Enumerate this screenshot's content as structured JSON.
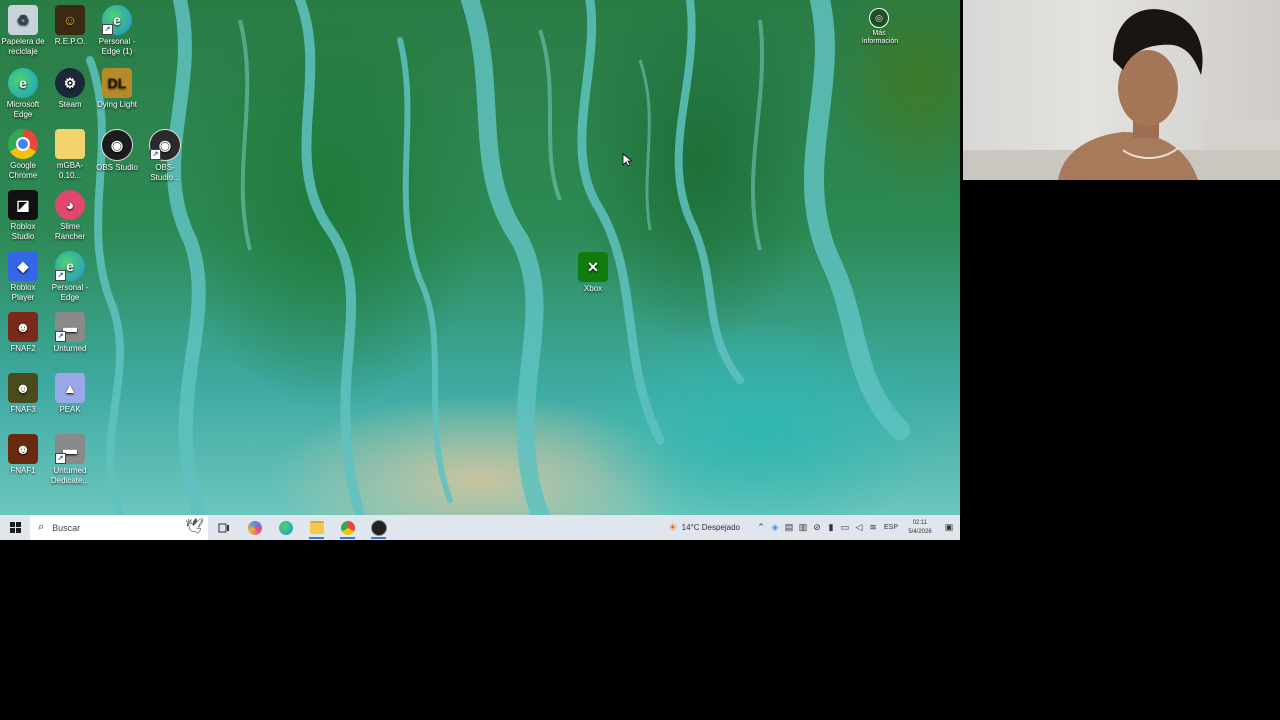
{
  "desktop": {
    "icons": [
      {
        "label": "Papelera de reciclaje",
        "icon": "recycle-bin-icon",
        "color": "#c8d3dc"
      },
      {
        "label": "R.E.P.O.",
        "icon": "repo-game-icon",
        "color": "#3a2a12"
      },
      {
        "label": "Personal - Edge (1)",
        "icon": "edge-icon",
        "color": "#1f8fd8"
      },
      {
        "label": "Microsoft Edge",
        "icon": "edge-icon",
        "color": "#1a9ad6"
      },
      {
        "label": "Steam",
        "icon": "steam-icon",
        "color": "#1b2838"
      },
      {
        "label": "Dying Light",
        "icon": "dying-light-icon",
        "color": "#b58a2a"
      },
      {
        "label": "Google Chrome",
        "icon": "chrome-icon",
        "color": "#e8453c"
      },
      {
        "label": "mGBA-0.10...",
        "icon": "folder-icon",
        "color": "#f2d36b"
      },
      {
        "label": "OBS Studio",
        "icon": "obs-icon",
        "color": "#1c1c1c"
      },
      {
        "label": "OBS-Studio...",
        "icon": "obs-icon",
        "color": "#2a2a2a"
      },
      {
        "label": "Roblox Studio",
        "icon": "roblox-studio-icon",
        "color": "#111111"
      },
      {
        "label": "Slime Rancher",
        "icon": "slime-rancher-icon",
        "color": "#e0466e"
      },
      {
        "label": "Roblox Player",
        "icon": "roblox-player-icon",
        "color": "#3566e6"
      },
      {
        "label": "Personal - Edge",
        "icon": "edge-icon",
        "color": "#1f8fd8"
      },
      {
        "label": "FNAF2",
        "icon": "fnaf2-icon",
        "color": "#7a2a1a"
      },
      {
        "label": "Unturned",
        "icon": "unturned-icon",
        "color": "#8a8a8a"
      },
      {
        "label": "FNAF3",
        "icon": "fnaf3-icon",
        "color": "#4a4a1a"
      },
      {
        "label": "PEAK",
        "icon": "peak-icon",
        "color": "#9aa7e8"
      },
      {
        "label": "FNAF1",
        "icon": "fnaf1-icon",
        "color": "#6a2a10"
      },
      {
        "label": "Unturned Dedicate...",
        "icon": "unturned-icon",
        "color": "#8a8a8a"
      },
      {
        "label": "Xbox",
        "icon": "xbox-icon",
        "color": "#107c10"
      }
    ],
    "info_widget": {
      "label": "Más información",
      "icon": "info-camera-icon"
    }
  },
  "taskbar": {
    "search_placeholder": "Buscar",
    "pinned": [
      {
        "name": "task-view",
        "icon": "task-view-icon",
        "color": "#3a3a3a"
      },
      {
        "name": "copilot",
        "icon": "copilot-icon",
        "color": "#4a8cf0"
      },
      {
        "name": "edge",
        "icon": "edge-icon",
        "color": "#1a9ad6"
      },
      {
        "name": "file-explorer",
        "icon": "folder-icon",
        "color": "#f2c94c"
      },
      {
        "name": "chrome",
        "icon": "chrome-icon",
        "color": "#e8453c"
      },
      {
        "name": "obs",
        "icon": "obs-icon",
        "color": "#222222"
      }
    ],
    "weather": {
      "text": "14°C Despejado",
      "icon": "weather-sun-icon"
    },
    "language": "ESP",
    "time": "02:11",
    "date": "5/4/2026"
  },
  "colors": {
    "taskbar": "#dfe6ee",
    "accent": "#3a7bd5"
  }
}
